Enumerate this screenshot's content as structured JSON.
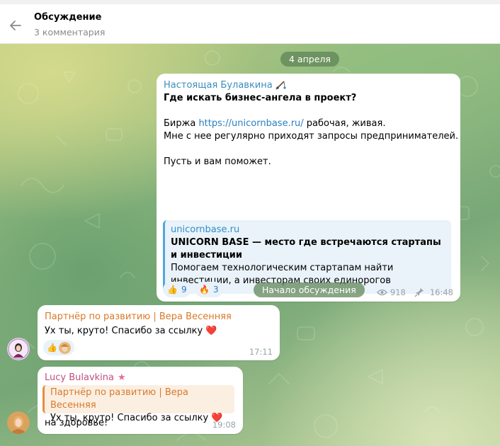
{
  "header": {
    "title": "Обсуждение",
    "subtitle": "3 комментария"
  },
  "date_pill": "4 апреля",
  "post": {
    "author": "Настоящая Булавкина",
    "headline": "Где искать бизнес-ангела в проект?",
    "line1_prefix": "Биржа ",
    "line1_link": "https://unicornbase.ru/",
    "line1_suffix": " рабочая, живая.",
    "line2": "Мне с нее регулярно приходят запросы предпринимателей.",
    "line3": "Пусть и вам поможет.",
    "preview": {
      "site": "unicornbase.ru",
      "title": "UNICORN BASE — место где встречаются стартапы и инвестиции",
      "description": "Помогаем технологическим стартапам найти инвестиции, а инвесторам своих единорогов"
    },
    "reactions": [
      {
        "emoji": "👍",
        "count": "9"
      },
      {
        "emoji": "🔥",
        "count": "3"
      }
    ],
    "views": "918",
    "time": "16:48"
  },
  "discussion_pill": "Начало обсуждения",
  "comment1": {
    "author": "Партнёр по развитию | Вера Весенняя",
    "text": "Ух ты, круто! Спасибо за ссылку",
    "heart": "❤️",
    "reaction_emoji": "👍",
    "time": "17:11"
  },
  "comment2": {
    "author": "Lucy Bulavkina",
    "star": "★",
    "quote_author": "Партнёр по развитию | Вера Весенняя",
    "quote_text": "Ух ты, круто! Спасибо за ссылку",
    "quote_heart": "❤️",
    "text": "на здоровье!",
    "time": "19:08"
  },
  "colors": {
    "author_blue": "#3a8ebd",
    "link_blue": "#2a7fc0",
    "partner_orange": "#d97a2c",
    "lucy_pink": "#c2507f",
    "pill_green": "#5c8253"
  }
}
